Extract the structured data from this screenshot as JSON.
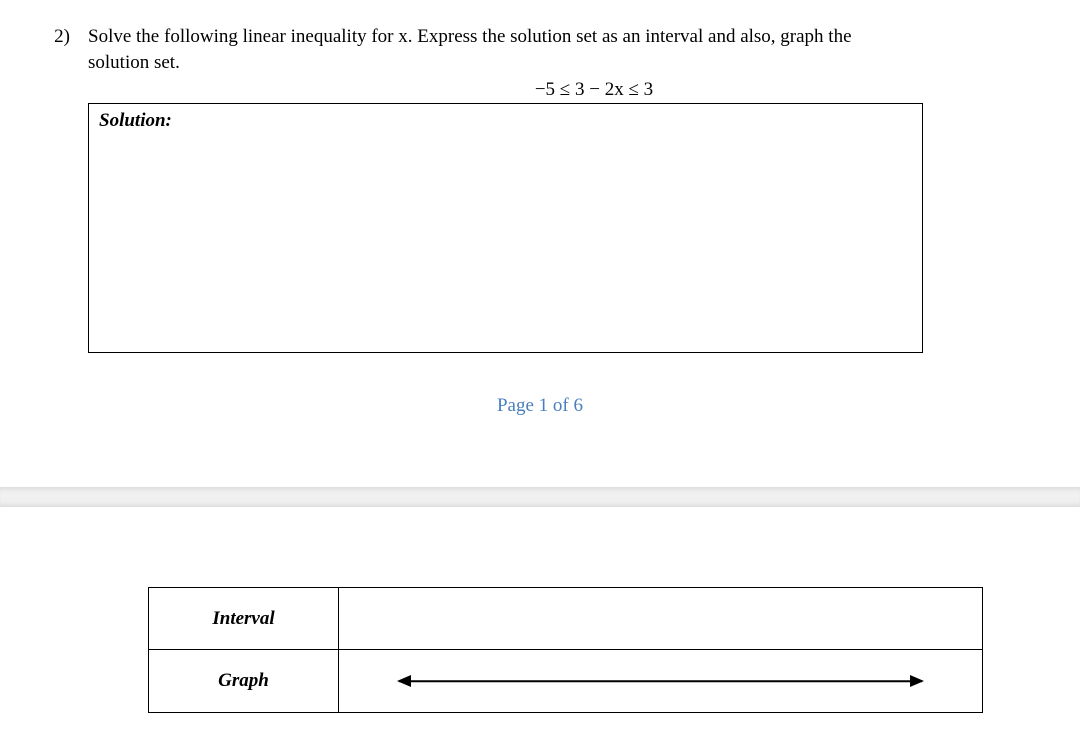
{
  "problem": {
    "number": "2)",
    "prompt_line1": "Solve the following linear inequality for x. Express the solution set as an interval and also, graph the",
    "prompt_line2": "solution set.",
    "equation": "−5 ≤ 3 − 2x ≤ 3",
    "solution_label": "Solution:"
  },
  "page_indicator": "Page 1 of 6",
  "answers": {
    "interval_label": "Interval",
    "graph_label": "Graph"
  }
}
